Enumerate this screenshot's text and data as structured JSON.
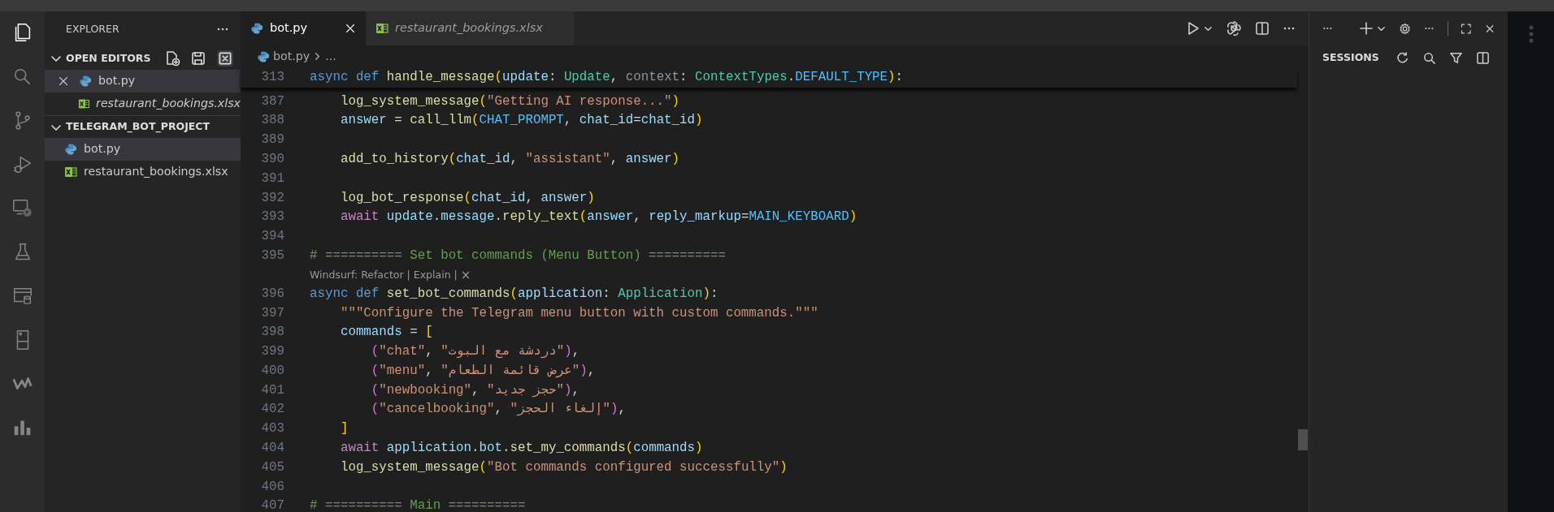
{
  "activity_bar": [
    {
      "selected": true
    },
    {
      "selected": false
    },
    {
      "selected": false
    },
    {
      "selected": false
    },
    {
      "selected": false
    },
    {
      "selected": false
    },
    {
      "selected": false
    },
    {
      "selected": false
    },
    {
      "selected": false
    },
    {
      "selected": false
    }
  ],
  "sidebar": {
    "title": "EXPLORER",
    "sections": [
      {
        "title": "OPEN EDITORS",
        "expanded": true,
        "items": [
          {
            "name": "bot.py",
            "kind": "python",
            "selected": true,
            "preview": false,
            "closable": true
          },
          {
            "name": "restaurant_bookings.xlsx",
            "kind": "excel",
            "selected": false,
            "preview": true,
            "closable": false
          }
        ]
      },
      {
        "title": "TELEGRAM_BOT_PROJECT",
        "expanded": true,
        "items": [
          {
            "name": "bot.py",
            "kind": "python",
            "selected": true,
            "preview": false,
            "closable": false
          },
          {
            "name": "restaurant_bookings.xlsx",
            "kind": "excel",
            "selected": false,
            "preview": false,
            "closable": false
          }
        ]
      }
    ]
  },
  "tabs": [
    {
      "label": "bot.py",
      "kind": "python",
      "selected": true,
      "preview": false
    },
    {
      "label": "restaurant_bookings.xlsx",
      "kind": "excel",
      "selected": false,
      "preview": true
    }
  ],
  "breadcrumb": {
    "file": "bot.py",
    "kind": "python",
    "rest": "..."
  },
  "sticky_line": {
    "number": "313",
    "tokens": [
      {
        "text": "async ",
        "kind": "kw"
      },
      {
        "text": "def ",
        "kind": "kw"
      },
      {
        "text": "handle_message",
        "kind": "fn"
      },
      {
        "text": "(",
        "kind": "b1"
      },
      {
        "text": "update",
        "kind": "var"
      },
      {
        "text": ": ",
        "kind": "p"
      },
      {
        "text": "Update",
        "kind": "type"
      },
      {
        "text": ", ",
        "kind": "p"
      },
      {
        "text": "context",
        "kind": "unused"
      },
      {
        "text": ": ",
        "kind": "p"
      },
      {
        "text": "ContextTypes",
        "kind": "type"
      },
      {
        "text": ".",
        "kind": "p"
      },
      {
        "text": "DEFAULT_TYPE",
        "kind": "const"
      },
      {
        "text": ")",
        "kind": "b1"
      },
      {
        "text": ":",
        "kind": "p"
      }
    ]
  },
  "lines": [
    {
      "kind": "code",
      "number": "387",
      "tokens": [
        {
          "text": "    log_system_message",
          "kind": "fn"
        },
        {
          "text": "(",
          "kind": "b1"
        },
        {
          "text": "\"Getting AI response...\"",
          "kind": "str"
        },
        {
          "text": ")",
          "kind": "b1"
        }
      ]
    },
    {
      "kind": "code",
      "number": "388",
      "tokens": [
        {
          "text": "    answer",
          "kind": "var"
        },
        {
          "text": " = ",
          "kind": "p"
        },
        {
          "text": "call_llm",
          "kind": "fn"
        },
        {
          "text": "(",
          "kind": "b1"
        },
        {
          "text": "CHAT_PROMPT",
          "kind": "const"
        },
        {
          "text": ", ",
          "kind": "p"
        },
        {
          "text": "chat_id",
          "kind": "var"
        },
        {
          "text": "=",
          "kind": "p"
        },
        {
          "text": "chat_id",
          "kind": "var"
        },
        {
          "text": ")",
          "kind": "b1"
        }
      ]
    },
    {
      "kind": "code",
      "number": "389"
    },
    {
      "kind": "code",
      "number": "390",
      "tokens": [
        {
          "text": "    add_to_history",
          "kind": "fn"
        },
        {
          "text": "(",
          "kind": "b1"
        },
        {
          "text": "chat_id",
          "kind": "var"
        },
        {
          "text": ", ",
          "kind": "p"
        },
        {
          "text": "\"assistant\"",
          "kind": "str"
        },
        {
          "text": ", ",
          "kind": "p"
        },
        {
          "text": "answer",
          "kind": "var"
        },
        {
          "text": ")",
          "kind": "b1"
        }
      ]
    },
    {
      "kind": "code",
      "number": "391"
    },
    {
      "kind": "code",
      "number": "392",
      "tokens": [
        {
          "text": "    log_bot_response",
          "kind": "fn"
        },
        {
          "text": "(",
          "kind": "b1"
        },
        {
          "text": "chat_id",
          "kind": "var"
        },
        {
          "text": ", ",
          "kind": "p"
        },
        {
          "text": "answer",
          "kind": "var"
        },
        {
          "text": ")",
          "kind": "b1"
        }
      ]
    },
    {
      "kind": "code",
      "number": "393",
      "tokens": [
        {
          "text": "    await ",
          "kind": "ctl"
        },
        {
          "text": "update",
          "kind": "var"
        },
        {
          "text": ".",
          "kind": "p"
        },
        {
          "text": "message",
          "kind": "var"
        },
        {
          "text": ".",
          "kind": "p"
        },
        {
          "text": "reply_text",
          "kind": "fn"
        },
        {
          "text": "(",
          "kind": "b1"
        },
        {
          "text": "answer",
          "kind": "var"
        },
        {
          "text": ", ",
          "kind": "p"
        },
        {
          "text": "reply_markup",
          "kind": "var"
        },
        {
          "text": "=",
          "kind": "p"
        },
        {
          "text": "MAIN_KEYBOARD",
          "kind": "const"
        },
        {
          "text": ")",
          "kind": "b1"
        }
      ]
    },
    {
      "kind": "code",
      "number": "394"
    },
    {
      "kind": "code",
      "number": "395",
      "tokens": [
        {
          "text": "# ========== Set bot commands (Menu Button) ==========",
          "kind": "cmt"
        }
      ]
    },
    {
      "kind": "codelens",
      "actions": [
        "Windsurf: Refactor",
        "Explain"
      ],
      "separator": "|",
      "close": "×"
    },
    {
      "kind": "code",
      "number": "396",
      "tokens": [
        {
          "text": "async ",
          "kind": "kw"
        },
        {
          "text": "def ",
          "kind": "kw"
        },
        {
          "text": "set_bot_commands",
          "kind": "fn"
        },
        {
          "text": "(",
          "kind": "b1"
        },
        {
          "text": "application",
          "kind": "var"
        },
        {
          "text": ": ",
          "kind": "p"
        },
        {
          "text": "Application",
          "kind": "type"
        },
        {
          "text": ")",
          "kind": "b1"
        },
        {
          "text": ":",
          "kind": "p"
        }
      ]
    },
    {
      "kind": "code",
      "number": "397",
      "tokens": [
        {
          "text": "    \"\"\"Configure the Telegram menu button with custom commands.\"\"\"",
          "kind": "str"
        }
      ]
    },
    {
      "kind": "code",
      "number": "398",
      "tokens": [
        {
          "text": "    commands",
          "kind": "var"
        },
        {
          "text": " = ",
          "kind": "p"
        },
        {
          "text": "[",
          "kind": "b1"
        }
      ]
    },
    {
      "kind": "code",
      "number": "399",
      "tokens": [
        {
          "text": "        (",
          "kind": "b2"
        },
        {
          "text": "\"chat\"",
          "kind": "str"
        },
        {
          "text": ", ",
          "kind": "p"
        },
        {
          "text": "\"دردشة مع البوت\"",
          "kind": "str"
        },
        {
          "text": ")",
          "kind": "b2"
        },
        {
          "text": ",",
          "kind": "p"
        }
      ]
    },
    {
      "kind": "code",
      "number": "400",
      "tokens": [
        {
          "text": "        (",
          "kind": "b2"
        },
        {
          "text": "\"menu\"",
          "kind": "str"
        },
        {
          "text": ", ",
          "kind": "p"
        },
        {
          "text": "\"عرض قائمة الطعام\"",
          "kind": "str"
        },
        {
          "text": ")",
          "kind": "b2"
        },
        {
          "text": ",",
          "kind": "p"
        }
      ]
    },
    {
      "kind": "code",
      "number": "401",
      "tokens": [
        {
          "text": "        (",
          "kind": "b2"
        },
        {
          "text": "\"newbooking\"",
          "kind": "str"
        },
        {
          "text": ", ",
          "kind": "p"
        },
        {
          "text": "\"حجز جديد\"",
          "kind": "str"
        },
        {
          "text": ")",
          "kind": "b2"
        },
        {
          "text": ",",
          "kind": "p"
        }
      ]
    },
    {
      "kind": "code",
      "number": "402",
      "tokens": [
        {
          "text": "        (",
          "kind": "b2"
        },
        {
          "text": "\"cancelbooking\"",
          "kind": "str"
        },
        {
          "text": ", ",
          "kind": "p"
        },
        {
          "text": "\"إلغاء الحجز\"",
          "kind": "str"
        },
        {
          "text": ")",
          "kind": "b2"
        },
        {
          "text": ",",
          "kind": "p"
        }
      ]
    },
    {
      "kind": "code",
      "number": "403",
      "tokens": [
        {
          "text": "    ]",
          "kind": "b1"
        }
      ]
    },
    {
      "kind": "code",
      "number": "404",
      "tokens": [
        {
          "text": "    await ",
          "kind": "ctl"
        },
        {
          "text": "application",
          "kind": "var"
        },
        {
          "text": ".",
          "kind": "p"
        },
        {
          "text": "bot",
          "kind": "var"
        },
        {
          "text": ".",
          "kind": "p"
        },
        {
          "text": "set_my_commands",
          "kind": "fn"
        },
        {
          "text": "(",
          "kind": "b1"
        },
        {
          "text": "commands",
          "kind": "var"
        },
        {
          "text": ")",
          "kind": "b1"
        }
      ]
    },
    {
      "kind": "code",
      "number": "405",
      "tokens": [
        {
          "text": "    log_system_message",
          "kind": "fn"
        },
        {
          "text": "(",
          "kind": "b1"
        },
        {
          "text": "\"Bot commands configured successfully\"",
          "kind": "str"
        },
        {
          "text": ")",
          "kind": "b1"
        }
      ]
    },
    {
      "kind": "code",
      "number": "406"
    },
    {
      "kind": "code",
      "number": "407",
      "tokens": [
        {
          "text": "# ========== Main ==========",
          "kind": "cmt"
        }
      ]
    }
  ],
  "sessions": {
    "title": "SESSIONS"
  }
}
